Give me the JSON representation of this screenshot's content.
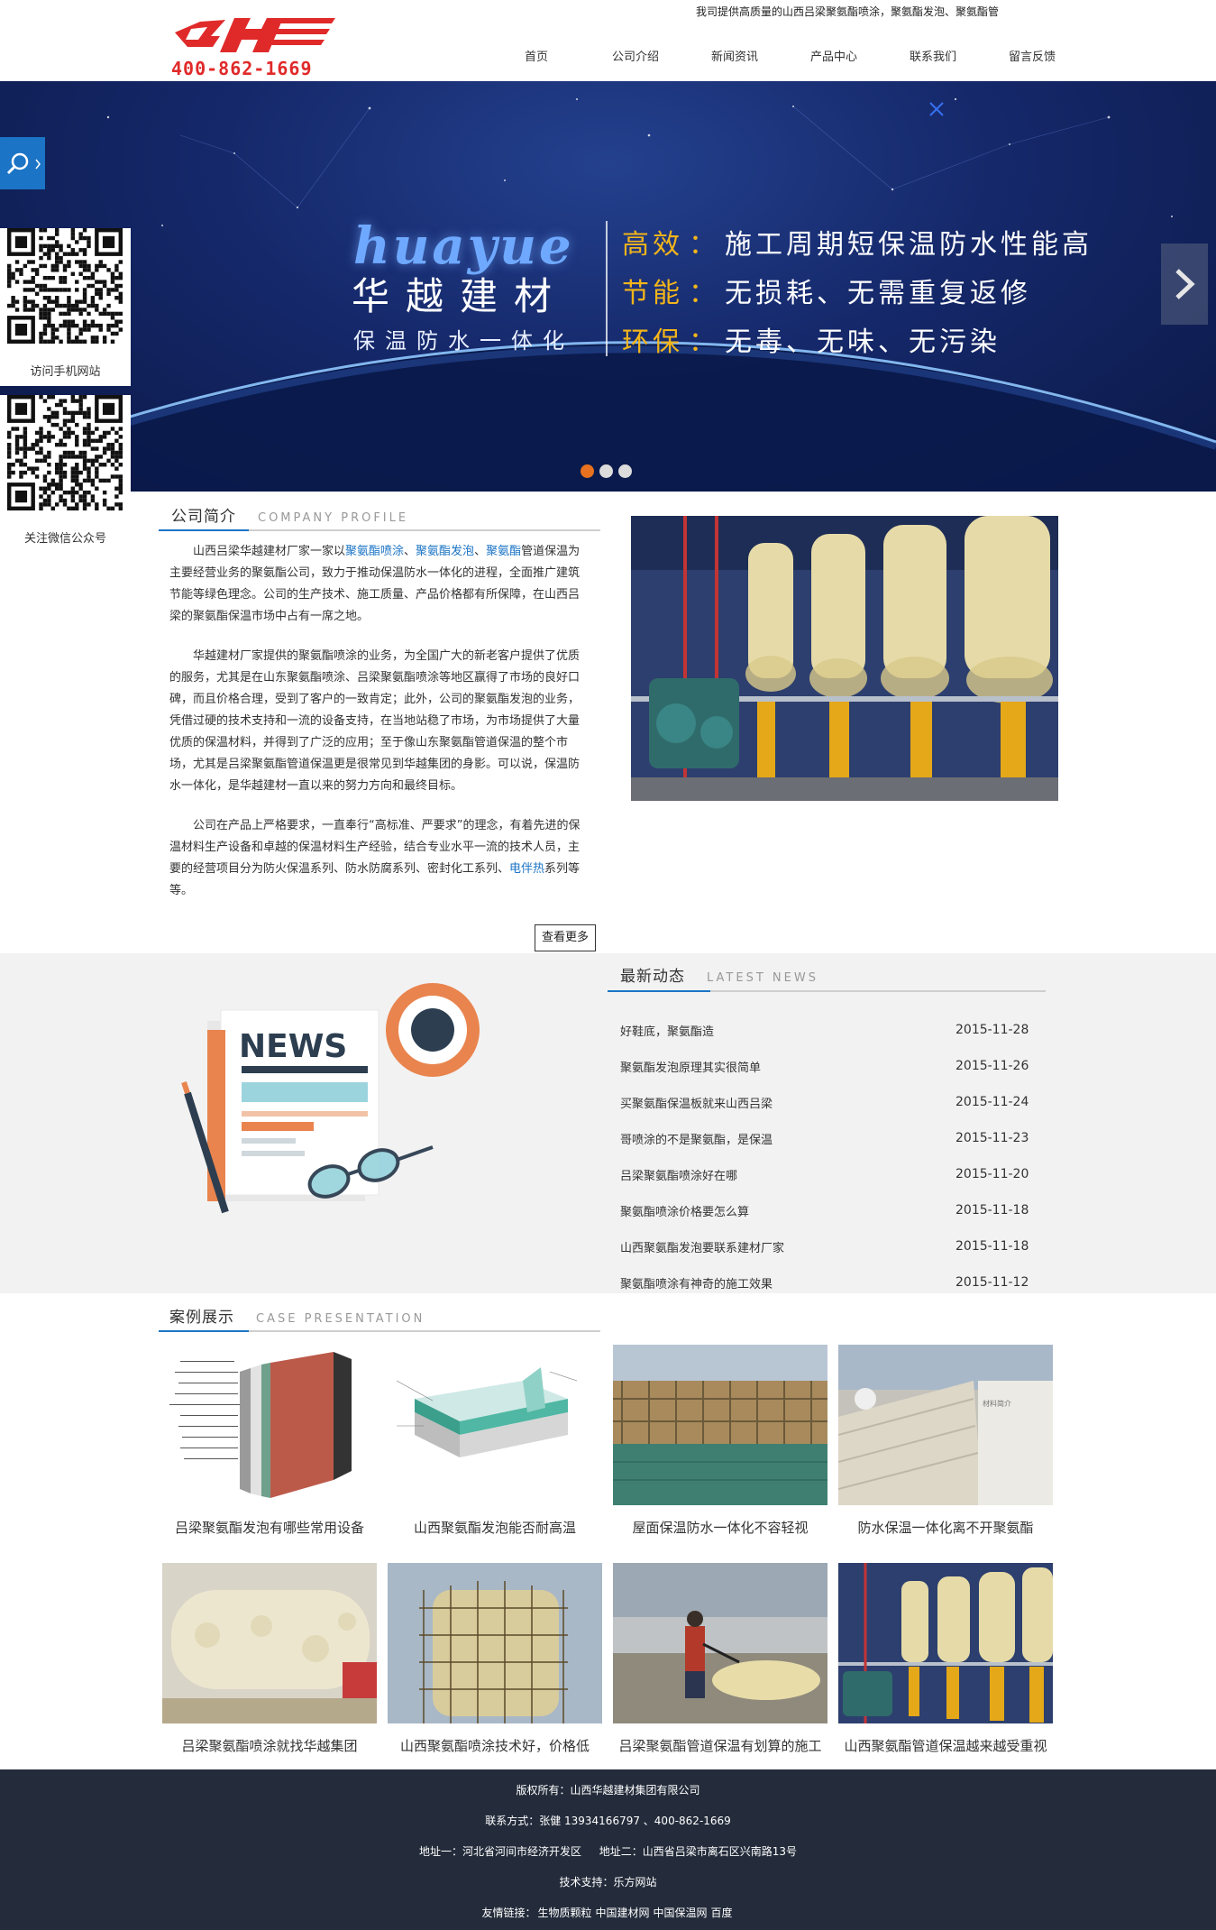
{
  "header": {
    "phone": "400-862-1669",
    "tagline": "我司提供高质量的山西吕梁聚氨酯喷涂，聚氨酯发泡、聚氨酯管",
    "nav": [
      "首页",
      "公司介绍",
      "新闻资讯",
      "产品中心",
      "联系我们",
      "留言反馈"
    ]
  },
  "banner": {
    "brand_en": "huayue",
    "brand_cn": "华越建材",
    "brand_sub": "保温防水一体化",
    "features": [
      {
        "key": "高效",
        "text": "施工周期短保温防水性能高"
      },
      {
        "key": "节能",
        "text": "无损耗、无需重复返修"
      },
      {
        "key": "环保",
        "text": "无毒、无味、无污染"
      }
    ],
    "colon": "："
  },
  "sidebar": {
    "qr1_label": "访问手机网站",
    "qr2_label": "关注微信公众号"
  },
  "about": {
    "title_cn": "公司简介",
    "title_en": "COMPANY PROFILE",
    "p1_pre": "山西吕梁华越建材厂家一家以",
    "p1_l1": "聚氨酯喷涂",
    "p1_s1": "、",
    "p1_l2": "聚氨酯发泡",
    "p1_s2": "、",
    "p1_l3": "聚氨酯",
    "p1_post": "管道保温为主要经营业务的聚氨酯公司，致力于推动保温防水一体化的进程，全面推广建筑节能等绿色理念。公司的生产技术、施工质量、产品价格都有所保障，在山西吕梁的聚氨酯保温市场中占有一席之地。",
    "p2": "华越建材厂家提供的聚氨酯喷涂的业务，为全国广大的新老客户提供了优质的服务，尤其是在山东聚氨酯喷涂、吕梁聚氨酯喷涂等地区赢得了市场的良好口碑，而且价格合理，受到了客户的一致肯定；此外，公司的聚氨酯发泡的业务，凭借过硬的技术支持和一流的设备支持，在当地站稳了市场，为市场提供了大量优质的保温材料，并得到了广泛的应用；至于像山东聚氨酯管道保温的整个市场，尤其是吕梁聚氨酯管道保温更是很常见到华越集团的身影。可以说，保温防水一体化，是华越建材一直以来的努力方向和最终目标。",
    "p3_pre": "公司在产品上严格要求，一直奉行“高标准、严要求”的理念，有着先进的保温材料生产设备和卓越的保温材料生产经验，结合专业水平一流的技术人员，主要的经营项目分为防火保温系列、防水防腐系列、密封化工系列、",
    "p3_link": "电伴热",
    "p3_post": "系列等等。",
    "more": "查看更多"
  },
  "news": {
    "title_cn": "最新动态",
    "title_en": "LATEST NEWS",
    "illus_word": "NEWS",
    "items": [
      {
        "title": "好鞋底，聚氨酯造",
        "date": "2015-11-28"
      },
      {
        "title": "聚氨酯发泡原理其实很简单",
        "date": "2015-11-26"
      },
      {
        "title": "买聚氨酯保温板就来山西吕梁",
        "date": "2015-11-24"
      },
      {
        "title": "哥喷涂的不是聚氨酯，是保温",
        "date": "2015-11-23"
      },
      {
        "title": "吕梁聚氨酯喷涂好在哪",
        "date": "2015-11-20"
      },
      {
        "title": "聚氨酯喷涂价格要怎么算",
        "date": "2015-11-18"
      },
      {
        "title": "山西聚氨酯发泡要联系建材厂家",
        "date": "2015-11-18"
      },
      {
        "title": "聚氨酯喷涂有神奇的施工效果",
        "date": "2015-11-12"
      }
    ]
  },
  "cases": {
    "title_cn": "案例展示",
    "title_en": "CASE PRESENTATION",
    "items": [
      {
        "caption": "吕梁聚氨酯发泡有哪些常用设备",
        "pic": "wall-layers"
      },
      {
        "caption": "山西聚氨酯发泡能否耐高温",
        "pic": "roof-layers"
      },
      {
        "caption": "屋面保温防水一体化不容轻视",
        "pic": "scaffold-site"
      },
      {
        "caption": "防水保温一体化离不开聚氨酯",
        "pic": "roof-spray"
      },
      {
        "caption": "吕梁聚氨酯喷涂就找华越集团",
        "pic": "tank-foam"
      },
      {
        "caption": "山西聚氨酯喷涂技术好，价格低",
        "pic": "silo-scaffold"
      },
      {
        "caption": "吕梁聚氨酯管道保温有划算的施工",
        "pic": "worker-spray"
      },
      {
        "caption": "山西聚氨酯管道保温越来越受重视",
        "pic": "plant-tanks"
      }
    ],
    "case4_overlay": "材料简介"
  },
  "footer": {
    "copyright": "版权所有：山西华越建材集团有限公司",
    "contact": "联系方式：张健 13934166797 、400-862-1669",
    "addr1": "地址一：河北省河间市经济开发区",
    "addr2": "地址二：山西省吕梁市离石区兴南路13号",
    "tech": "技术支持：乐方网站",
    "links_label": "友情链接：",
    "links": [
      "生物质颗粒",
      "中国建材网",
      "中国保温网",
      "百度"
    ]
  }
}
